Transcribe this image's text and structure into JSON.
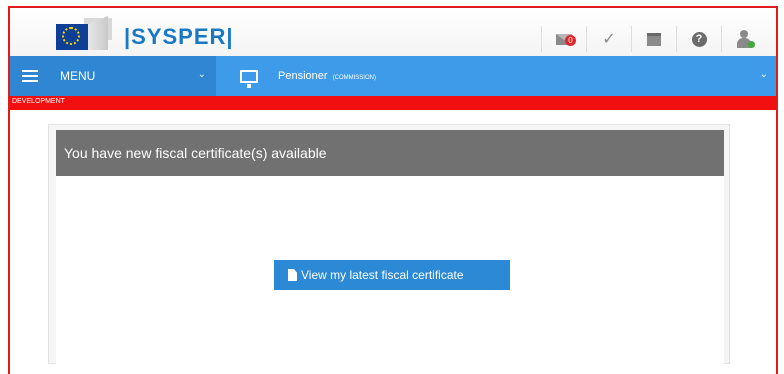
{
  "header": {
    "app_name": "SYSPER",
    "icons": [
      "envelope-icon",
      "check-icon",
      "calendar-icon",
      "help-icon",
      "user-icon"
    ],
    "notification_count": "0"
  },
  "nav": {
    "menu_label": "MENU",
    "role_label": "Pensioner",
    "role_org": "(COMMISSION)"
  },
  "environment": {
    "label": "DEVELOPMENT",
    "color": "#f20f0f"
  },
  "notice": {
    "title": "You have new fiscal certificate(s) available",
    "button_label": "View my latest fiscal certificate"
  },
  "colors": {
    "brand_blue": "#1778c6",
    "nav_blue": "#3d9be9",
    "button_blue": "#2b89d6",
    "header_gray": "#717171"
  }
}
